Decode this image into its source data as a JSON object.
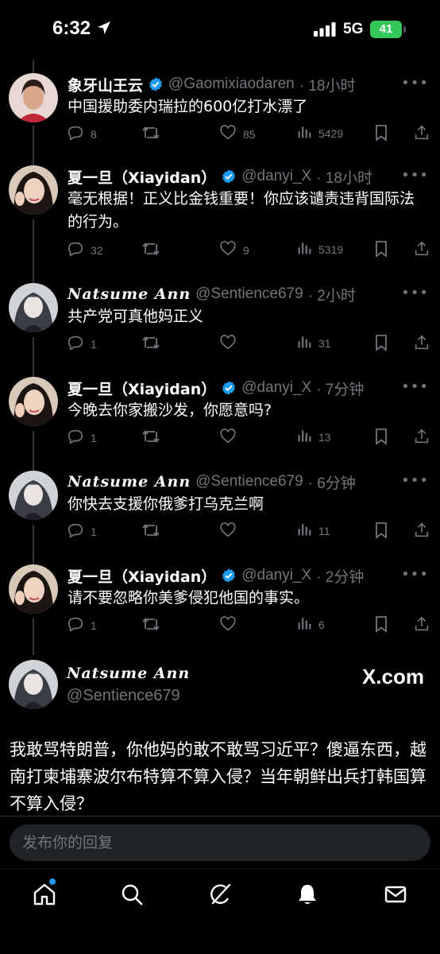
{
  "status": {
    "time": "6:32",
    "network": "5G",
    "battery": "41"
  },
  "tweets": [
    {
      "name": "象牙山王云",
      "handle": "@Gaomixiaodaren",
      "time": "· 18小时",
      "text": "中国援助委内瑞拉的600亿打水漂了",
      "replies": "8",
      "retweets": "",
      "likes": "85",
      "views": "5429",
      "avatar": "woman-red"
    },
    {
      "name": "夏一旦（Xiayidan）",
      "handle": "@danyi_X",
      "time": "· 18小时",
      "text": "毫无根据！正义比金钱重要！你应该谴责违背国际法的行为。",
      "replies": "32",
      "retweets": "",
      "likes": "9",
      "views": "5319",
      "avatar": "woman"
    },
    {
      "name": "Natsume Ann",
      "handle": "@Sentience679",
      "time": "· 2小时",
      "text": "共产党可真他妈正义",
      "replies": "1",
      "retweets": "",
      "likes": "",
      "views": "31",
      "avatar": "anime"
    },
    {
      "name": "夏一旦（Xiayidan）",
      "handle": "@danyi_X",
      "time": "· 7分钟",
      "text": "今晚去你家搬沙发，你愿意吗?",
      "replies": "1",
      "retweets": "",
      "likes": "",
      "views": "13",
      "avatar": "woman"
    },
    {
      "name": "Natsume Ann",
      "handle": "@Sentience679",
      "time": "· 6分钟",
      "text": "你快去支援你俄爹打乌克兰啊",
      "replies": "1",
      "retweets": "",
      "likes": "",
      "views": "11",
      "avatar": "anime"
    },
    {
      "name": "夏一旦（Xiayidan）",
      "handle": "@danyi_X",
      "time": "· 2分钟",
      "text": "请不要忽略你美爹侵犯他国的事实。",
      "replies": "1",
      "retweets": "",
      "likes": "",
      "views": "6",
      "avatar": "woman"
    }
  ],
  "main": {
    "name": "Natsume Ann",
    "handle": "@Sentience679",
    "brand": "X.com",
    "text": "我敢骂特朗普，你他妈的敢不敢骂习近平？傻逼东西，越南打柬埔寨波尔布特算不算入侵？当年朝鲜出兵打韩国算不算入侵？"
  },
  "reply": {
    "placeholder": "发布你的回复"
  },
  "colors": {
    "background": "#000000",
    "muted": "#71767b",
    "accent": "#1d9bf0",
    "verified": "#1d9bf0",
    "battery": "#34c759"
  },
  "tabs": [
    "home-icon",
    "search-icon",
    "grok-icon",
    "notifications-icon",
    "messages-icon"
  ]
}
